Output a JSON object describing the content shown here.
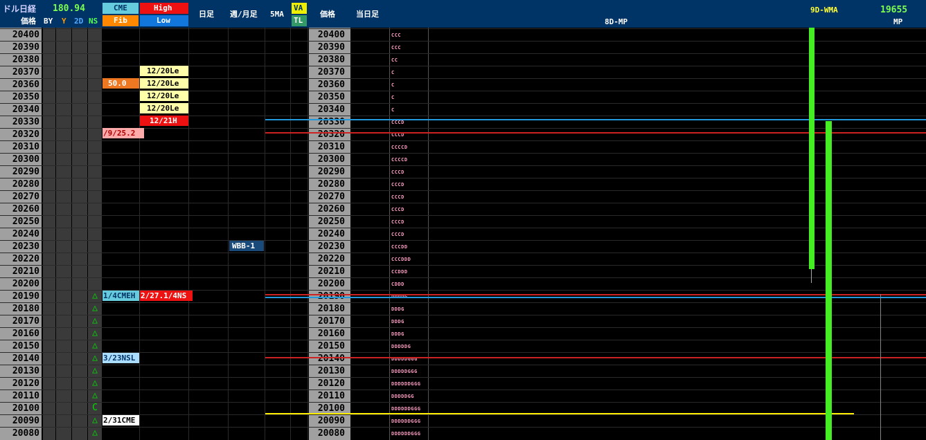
{
  "header": {
    "instrument_label": "ドル日経",
    "usdjpy_value": "180.94",
    "price_header_left": "価格",
    "col_by": "BY",
    "col_y": "Y",
    "col_2d": "2D",
    "col_ns": "NS",
    "cme_label": "CME",
    "fib_label": "Fib",
    "high_label": "High",
    "low_label": "Low",
    "daily_label": "日足",
    "weekly_label": "週/月足",
    "ma_label": "5MA",
    "va_label": "VA",
    "tl_label": "TL",
    "price_header_mid": "価格",
    "today_label": "当日足",
    "mp_8d_label": "8D-MP",
    "wma_label": "9D-WMA",
    "wma_value": "19655",
    "mp_label": "MP"
  },
  "prices": [
    "20400",
    "20390",
    "20380",
    "20370",
    "20360",
    "20350",
    "20340",
    "20330",
    "20320",
    "20310",
    "20300",
    "20290",
    "20280",
    "20270",
    "20260",
    "20250",
    "20240",
    "20230",
    "20220",
    "20210",
    "20200",
    "20190",
    "20180",
    "20170",
    "20160",
    "20150",
    "20140",
    "20130",
    "20120",
    "20110",
    "20100",
    "20090",
    "20080"
  ],
  "tpo": [
    "CCC",
    "CCC",
    "CC",
    "C",
    "C",
    "C",
    "C",
    "CCCD",
    "CCCD",
    "CCCCD",
    "CCCCD",
    "CCCD",
    "CCCD",
    "CCCD",
    "CCCD",
    "CCCD",
    "CCCD",
    "CCCDD",
    "CCCDDD",
    "CCDDD",
    "CDDD",
    "DDDDG",
    "DDDG",
    "DDDG",
    "DDDG",
    "DDDDDG",
    "DDDDDGGG",
    "DDDDDGGG",
    "DDDDDDGGG",
    "DDDDDGG",
    "DDDDDDGGG",
    "DDDDDDGGG",
    "DDDDDDGGG"
  ],
  "ns_marks": [
    "△",
    "△",
    "△",
    "△",
    "△",
    "△",
    "△",
    "△",
    "△",
    "C",
    "△",
    "△"
  ],
  "labels": {
    "fib_50": "50.0",
    "low_1": "12/20Le",
    "low_2": "12/20Le",
    "low_3": "12/20Le",
    "low_4": "12/20Le",
    "high_1221": "12/21H",
    "pink_925": "/9/25.2",
    "wbb": "WBB-1",
    "cme_14": "1/4CMEH",
    "high_27": "2/27.1/4NS",
    "nsl_323": "3/23NSL",
    "cme_231": "2/31CME"
  },
  "colors": {
    "header_bg": "#003366",
    "price_col": "#a0a0a0",
    "green_bar": "#44ee22",
    "red_line": "#cc2222",
    "blue_line": "#2299dd",
    "yellow_line": "#ffee00",
    "tpo_text": "#ff9ec4"
  }
}
